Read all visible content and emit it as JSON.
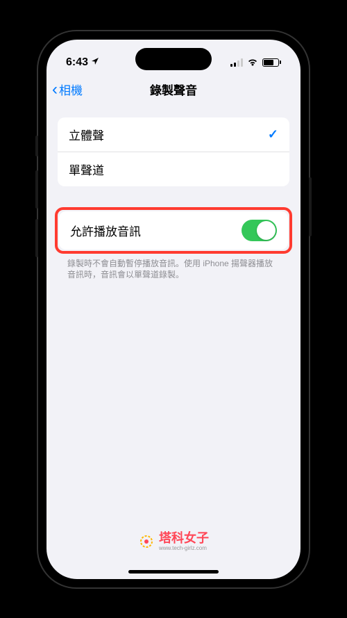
{
  "statusBar": {
    "time": "6:43"
  },
  "nav": {
    "backLabel": "相機",
    "title": "錄製聲音"
  },
  "soundOptions": [
    {
      "label": "立體聲",
      "selected": true
    },
    {
      "label": "單聲道",
      "selected": false
    }
  ],
  "allowPlayback": {
    "label": "允許播放音訊",
    "enabled": true
  },
  "footerNote": "錄製時不會自動暫停播放音訊。使用 iPhone 揚聲器播放音訊時，音訊會以單聲道錄製。",
  "watermark": {
    "main": "塔科女子",
    "sub": "www.tech-girlz.com"
  }
}
